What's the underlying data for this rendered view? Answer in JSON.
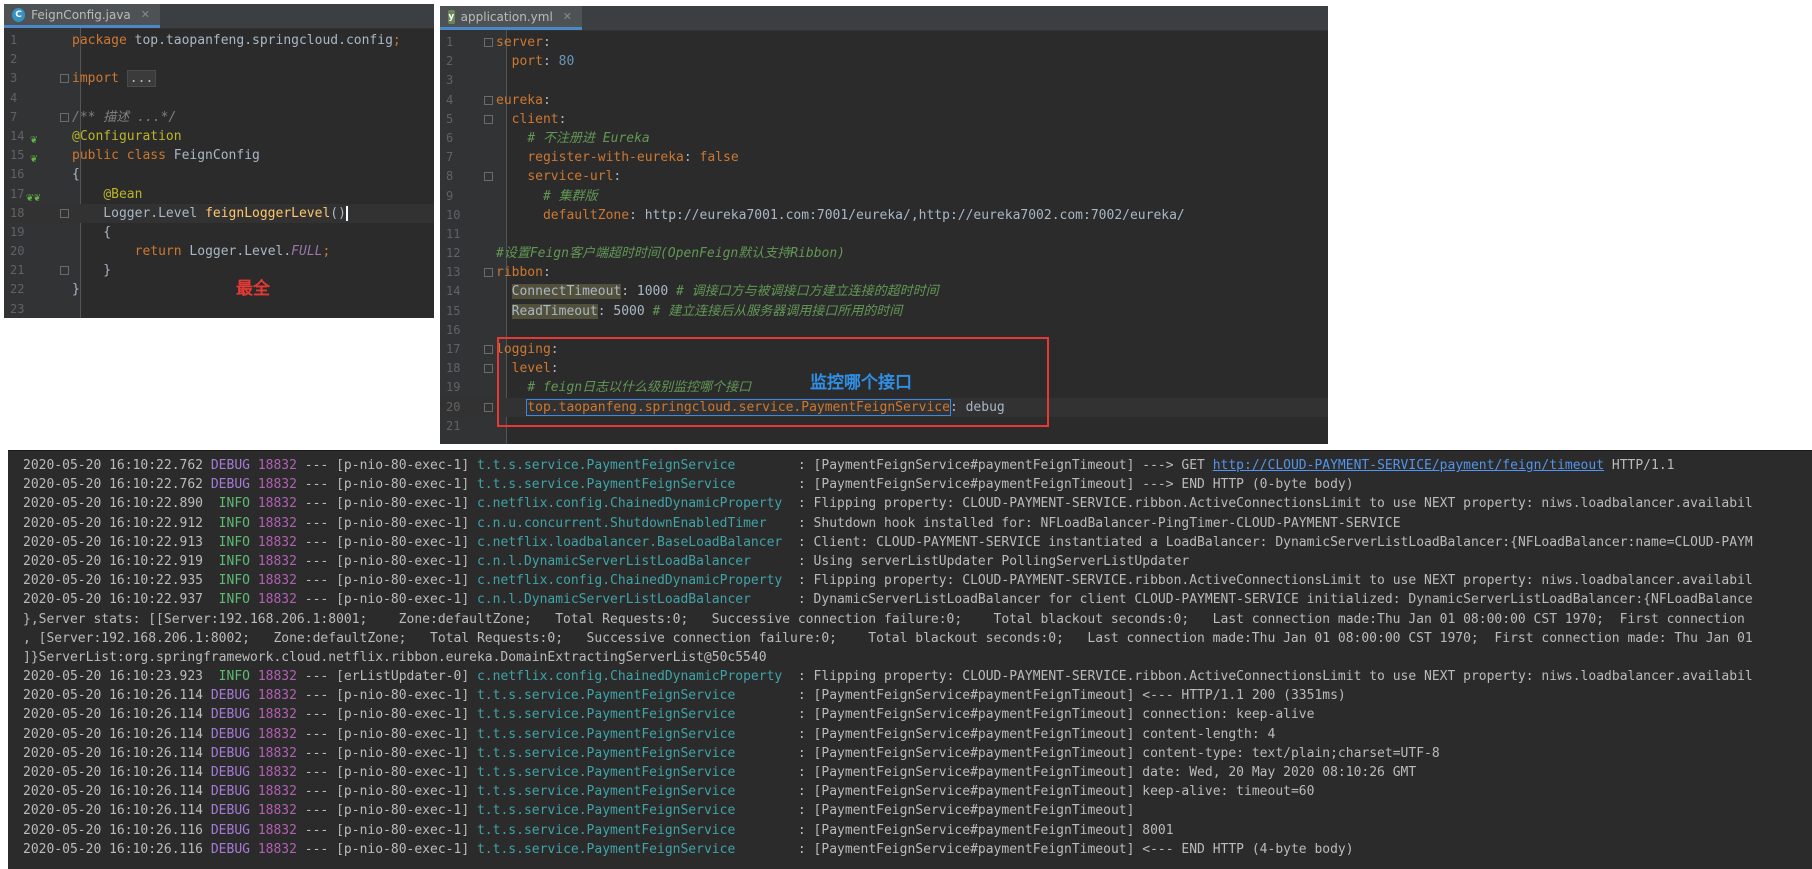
{
  "java_editor": {
    "tab_label": "FeignConfig.java",
    "lines": [
      {
        "n": "1",
        "segs": [
          [
            "kw",
            "package "
          ],
          [
            "",
            "top.taopanfeng.springcloud.config"
          ],
          [
            "kw",
            ";"
          ]
        ]
      },
      {
        "n": "2",
        "segs": []
      },
      {
        "n": "3",
        "segs": [
          [
            "kw",
            "import "
          ],
          [
            "folded",
            "..."
          ]
        ]
      },
      {
        "n": "4",
        "segs": []
      },
      {
        "n": "7",
        "segs": [
          [
            "cmg",
            "/** 描述 ...*/"
          ]
        ]
      },
      {
        "n": "14",
        "segs": [
          [
            "ann",
            "@Configuration"
          ]
        ]
      },
      {
        "n": "15",
        "segs": [
          [
            "kw",
            "public class "
          ],
          [
            "",
            "FeignConfig"
          ]
        ]
      },
      {
        "n": "16",
        "segs": [
          [
            "",
            "{"
          ]
        ]
      },
      {
        "n": "17",
        "segs": [
          [
            "",
            "    "
          ],
          [
            "ann",
            "@Bean"
          ]
        ]
      },
      {
        "n": "18",
        "segs": [
          [
            "",
            "    Logger.Level "
          ],
          [
            "fn",
            "feignLoggerLevel"
          ],
          [
            "",
            "()"
          ]
        ]
      },
      {
        "n": "19",
        "segs": [
          [
            "",
            "    {"
          ]
        ]
      },
      {
        "n": "20",
        "segs": [
          [
            "",
            "        "
          ],
          [
            "kw",
            "return "
          ],
          [
            "",
            "Logger.Level."
          ],
          [
            "italic",
            "FULL"
          ],
          [
            "kw",
            ";"
          ]
        ]
      },
      {
        "n": "21",
        "segs": [
          [
            "",
            "    }"
          ]
        ]
      },
      {
        "n": "22",
        "segs": [
          [
            "",
            "}"
          ]
        ]
      },
      {
        "n": "23",
        "segs": []
      }
    ],
    "annotation": "最全"
  },
  "yml_editor": {
    "tab_label": "application.yml",
    "lines": [
      {
        "n": "1",
        "segs": [
          [
            "key",
            "server"
          ],
          [
            "",
            ":"
          ]
        ]
      },
      {
        "n": "2",
        "segs": [
          [
            "",
            "  "
          ],
          [
            "key",
            "port"
          ],
          [
            "",
            ": "
          ],
          [
            "num",
            "80"
          ]
        ]
      },
      {
        "n": "3",
        "segs": []
      },
      {
        "n": "4",
        "segs": [
          [
            "key",
            "eureka"
          ],
          [
            "",
            ":"
          ]
        ]
      },
      {
        "n": "5",
        "segs": [
          [
            "",
            "  "
          ],
          [
            "key",
            "client"
          ],
          [
            "",
            ":"
          ]
        ]
      },
      {
        "n": "6",
        "segs": [
          [
            "",
            "    "
          ],
          [
            "cm",
            "# 不注册进 Eureka"
          ]
        ]
      },
      {
        "n": "7",
        "segs": [
          [
            "",
            "    "
          ],
          [
            "key",
            "register-with-eureka"
          ],
          [
            "",
            ": "
          ],
          [
            "kw",
            "false"
          ]
        ]
      },
      {
        "n": "8",
        "segs": [
          [
            "",
            "    "
          ],
          [
            "key",
            "service-url"
          ],
          [
            "",
            ":"
          ]
        ]
      },
      {
        "n": "9",
        "segs": [
          [
            "",
            "      "
          ],
          [
            "cm",
            "# 集群版"
          ]
        ]
      },
      {
        "n": "10",
        "segs": [
          [
            "",
            "      "
          ],
          [
            "key",
            "defaultZone"
          ],
          [
            "",
            ": http://eureka7001.com:7001/eureka/,http://eureka7002.com:7002/eureka/"
          ]
        ]
      },
      {
        "n": "11",
        "segs": []
      },
      {
        "n": "12",
        "segs": [
          [
            "cm",
            "#设置Feign客户端超时时间(OpenFeign默认支持Ribbon)"
          ]
        ]
      },
      {
        "n": "13",
        "segs": [
          [
            "key",
            "ribbon"
          ],
          [
            "",
            ":"
          ]
        ]
      },
      {
        "n": "14",
        "segs": [
          [
            "",
            "  "
          ],
          [
            "hlkey",
            "ConnectTimeout"
          ],
          [
            "",
            ": 1000 "
          ],
          [
            "cm",
            "# 调接口方与被调接口方建立连接的超时时间"
          ]
        ]
      },
      {
        "n": "15",
        "segs": [
          [
            "",
            "  "
          ],
          [
            "hlkey",
            "ReadTimeout"
          ],
          [
            "",
            ": 5000 "
          ],
          [
            "cm",
            "# 建立连接后从服务器调用接口所用的时间"
          ]
        ]
      },
      {
        "n": "16",
        "segs": []
      },
      {
        "n": "17",
        "segs": [
          [
            "key",
            "logging"
          ],
          [
            "",
            ":"
          ]
        ]
      },
      {
        "n": "18",
        "segs": [
          [
            "",
            "  "
          ],
          [
            "key",
            "level"
          ],
          [
            "",
            ":"
          ]
        ]
      },
      {
        "n": "19",
        "segs": [
          [
            "",
            "    "
          ],
          [
            "cm",
            "# feign日志以什么级别监控哪个接口"
          ]
        ]
      },
      {
        "n": "20",
        "segs": [
          [
            "",
            "    "
          ],
          [
            "boxkey",
            "top.taopanfeng.springcloud.service.PaymentFeignService"
          ],
          [
            "",
            ": debug"
          ]
        ]
      },
      {
        "n": "21",
        "segs": []
      }
    ],
    "annotation": "监控哪个接口"
  },
  "console": {
    "lines": [
      {
        "date": "2020-05-20 16:10:22.762",
        "level": "DEBUG",
        "pid": "18832",
        "thread": "--- [p-nio-80-exec-1]",
        "logger": "t.t.s.service.PaymentFeignService       ",
        "msg": " : [PaymentFeignService#paymentFeignTimeout] ---> GET ",
        "link": "http://CLOUD-PAYMENT-SERVICE/payment/feign/timeout",
        "tail": " HTTP/1.1"
      },
      {
        "date": "2020-05-20 16:10:22.762",
        "level": "DEBUG",
        "pid": "18832",
        "thread": "--- [p-nio-80-exec-1]",
        "logger": "t.t.s.service.PaymentFeignService       ",
        "msg": " : [PaymentFeignService#paymentFeignTimeout] ---> END HTTP (0-byte body)"
      },
      {
        "date": "2020-05-20 16:10:22.890",
        "level": " INFO",
        "pid": "18832",
        "thread": "--- [p-nio-80-exec-1]",
        "logger": "c.netflix.config.ChainedDynamicProperty ",
        "msg": " : Flipping property: CLOUD-PAYMENT-SERVICE.ribbon.ActiveConnectionsLimit to use NEXT property: niws.loadbalancer.availabil"
      },
      {
        "date": "2020-05-20 16:10:22.912",
        "level": " INFO",
        "pid": "18832",
        "thread": "--- [p-nio-80-exec-1]",
        "logger": "c.n.u.concurrent.ShutdownEnabledTimer   ",
        "msg": " : Shutdown hook installed for: NFLoadBalancer-PingTimer-CLOUD-PAYMENT-SERVICE"
      },
      {
        "date": "2020-05-20 16:10:22.913",
        "level": " INFO",
        "pid": "18832",
        "thread": "--- [p-nio-80-exec-1]",
        "logger": "c.netflix.loadbalancer.BaseLoadBalancer ",
        "msg": " : Client: CLOUD-PAYMENT-SERVICE instantiated a LoadBalancer: DynamicServerListLoadBalancer:{NFLoadBalancer:name=CLOUD-PAYM"
      },
      {
        "date": "2020-05-20 16:10:22.919",
        "level": " INFO",
        "pid": "18832",
        "thread": "--- [p-nio-80-exec-1]",
        "logger": "c.n.l.DynamicServerListLoadBalancer     ",
        "msg": " : Using serverListUpdater PollingServerListUpdater"
      },
      {
        "date": "2020-05-20 16:10:22.935",
        "level": " INFO",
        "pid": "18832",
        "thread": "--- [p-nio-80-exec-1]",
        "logger": "c.netflix.config.ChainedDynamicProperty ",
        "msg": " : Flipping property: CLOUD-PAYMENT-SERVICE.ribbon.ActiveConnectionsLimit to use NEXT property: niws.loadbalancer.availabil"
      },
      {
        "date": "2020-05-20 16:10:22.937",
        "level": " INFO",
        "pid": "18832",
        "thread": "--- [p-nio-80-exec-1]",
        "logger": "c.n.l.DynamicServerListLoadBalancer     ",
        "msg": " : DynamicServerListLoadBalancer for client CLOUD-PAYMENT-SERVICE initialized: DynamicServerListLoadBalancer:{NFLoadBalance"
      },
      {
        "plain": "},Server stats: [[Server:192.168.206.1:8001;    Zone:defaultZone;   Total Requests:0;   Successive connection failure:0;    Total blackout seconds:0;   Last connection made:Thu Jan 01 08:00:00 CST 1970;  First connection"
      },
      {
        "plain": ", [Server:192.168.206.1:8002;   Zone:defaultZone;   Total Requests:0;   Successive connection failure:0;    Total blackout seconds:0;   Last connection made:Thu Jan 01 08:00:00 CST 1970;  First connection made: Thu Jan 01"
      },
      {
        "plain": "]}ServerList:org.springframework.cloud.netflix.ribbon.eureka.DomainExtractingServerList@50c5540"
      },
      {
        "date": "2020-05-20 16:10:23.923",
        "level": " INFO",
        "pid": "18832",
        "thread": "--- [erListUpdater-0]",
        "logger": "c.netflix.config.ChainedDynamicProperty ",
        "msg": " : Flipping property: CLOUD-PAYMENT-SERVICE.ribbon.ActiveConnectionsLimit to use NEXT property: niws.loadbalancer.availabil"
      },
      {
        "date": "2020-05-20 16:10:26.114",
        "level": "DEBUG",
        "pid": "18832",
        "thread": "--- [p-nio-80-exec-1]",
        "logger": "t.t.s.service.PaymentFeignService       ",
        "msg": " : [PaymentFeignService#paymentFeignTimeout] <--- HTTP/1.1 200 (3351ms)"
      },
      {
        "date": "2020-05-20 16:10:26.114",
        "level": "DEBUG",
        "pid": "18832",
        "thread": "--- [p-nio-80-exec-1]",
        "logger": "t.t.s.service.PaymentFeignService       ",
        "msg": " : [PaymentFeignService#paymentFeignTimeout] connection: keep-alive"
      },
      {
        "date": "2020-05-20 16:10:26.114",
        "level": "DEBUG",
        "pid": "18832",
        "thread": "--- [p-nio-80-exec-1]",
        "logger": "t.t.s.service.PaymentFeignService       ",
        "msg": " : [PaymentFeignService#paymentFeignTimeout] content-length: 4"
      },
      {
        "date": "2020-05-20 16:10:26.114",
        "level": "DEBUG",
        "pid": "18832",
        "thread": "--- [p-nio-80-exec-1]",
        "logger": "t.t.s.service.PaymentFeignService       ",
        "msg": " : [PaymentFeignService#paymentFeignTimeout] content-type: text/plain;charset=UTF-8"
      },
      {
        "date": "2020-05-20 16:10:26.114",
        "level": "DEBUG",
        "pid": "18832",
        "thread": "--- [p-nio-80-exec-1]",
        "logger": "t.t.s.service.PaymentFeignService       ",
        "msg": " : [PaymentFeignService#paymentFeignTimeout] date: Wed, 20 May 2020 08:10:26 GMT"
      },
      {
        "date": "2020-05-20 16:10:26.114",
        "level": "DEBUG",
        "pid": "18832",
        "thread": "--- [p-nio-80-exec-1]",
        "logger": "t.t.s.service.PaymentFeignService       ",
        "msg": " : [PaymentFeignService#paymentFeignTimeout] keep-alive: timeout=60"
      },
      {
        "date": "2020-05-20 16:10:26.114",
        "level": "DEBUG",
        "pid": "18832",
        "thread": "--- [p-nio-80-exec-1]",
        "logger": "t.t.s.service.PaymentFeignService       ",
        "msg": " : [PaymentFeignService#paymentFeignTimeout]"
      },
      {
        "date": "2020-05-20 16:10:26.116",
        "level": "DEBUG",
        "pid": "18832",
        "thread": "--- [p-nio-80-exec-1]",
        "logger": "t.t.s.service.PaymentFeignService       ",
        "msg": " : [PaymentFeignService#paymentFeignTimeout] 8001"
      },
      {
        "date": "2020-05-20 16:10:26.116",
        "level": "DEBUG",
        "pid": "18832",
        "thread": "--- [p-nio-80-exec-1]",
        "logger": "t.t.s.service.PaymentFeignService       ",
        "msg": " : [PaymentFeignService#paymentFeignTimeout] <--- END HTTP (4-byte body)"
      }
    ]
  }
}
